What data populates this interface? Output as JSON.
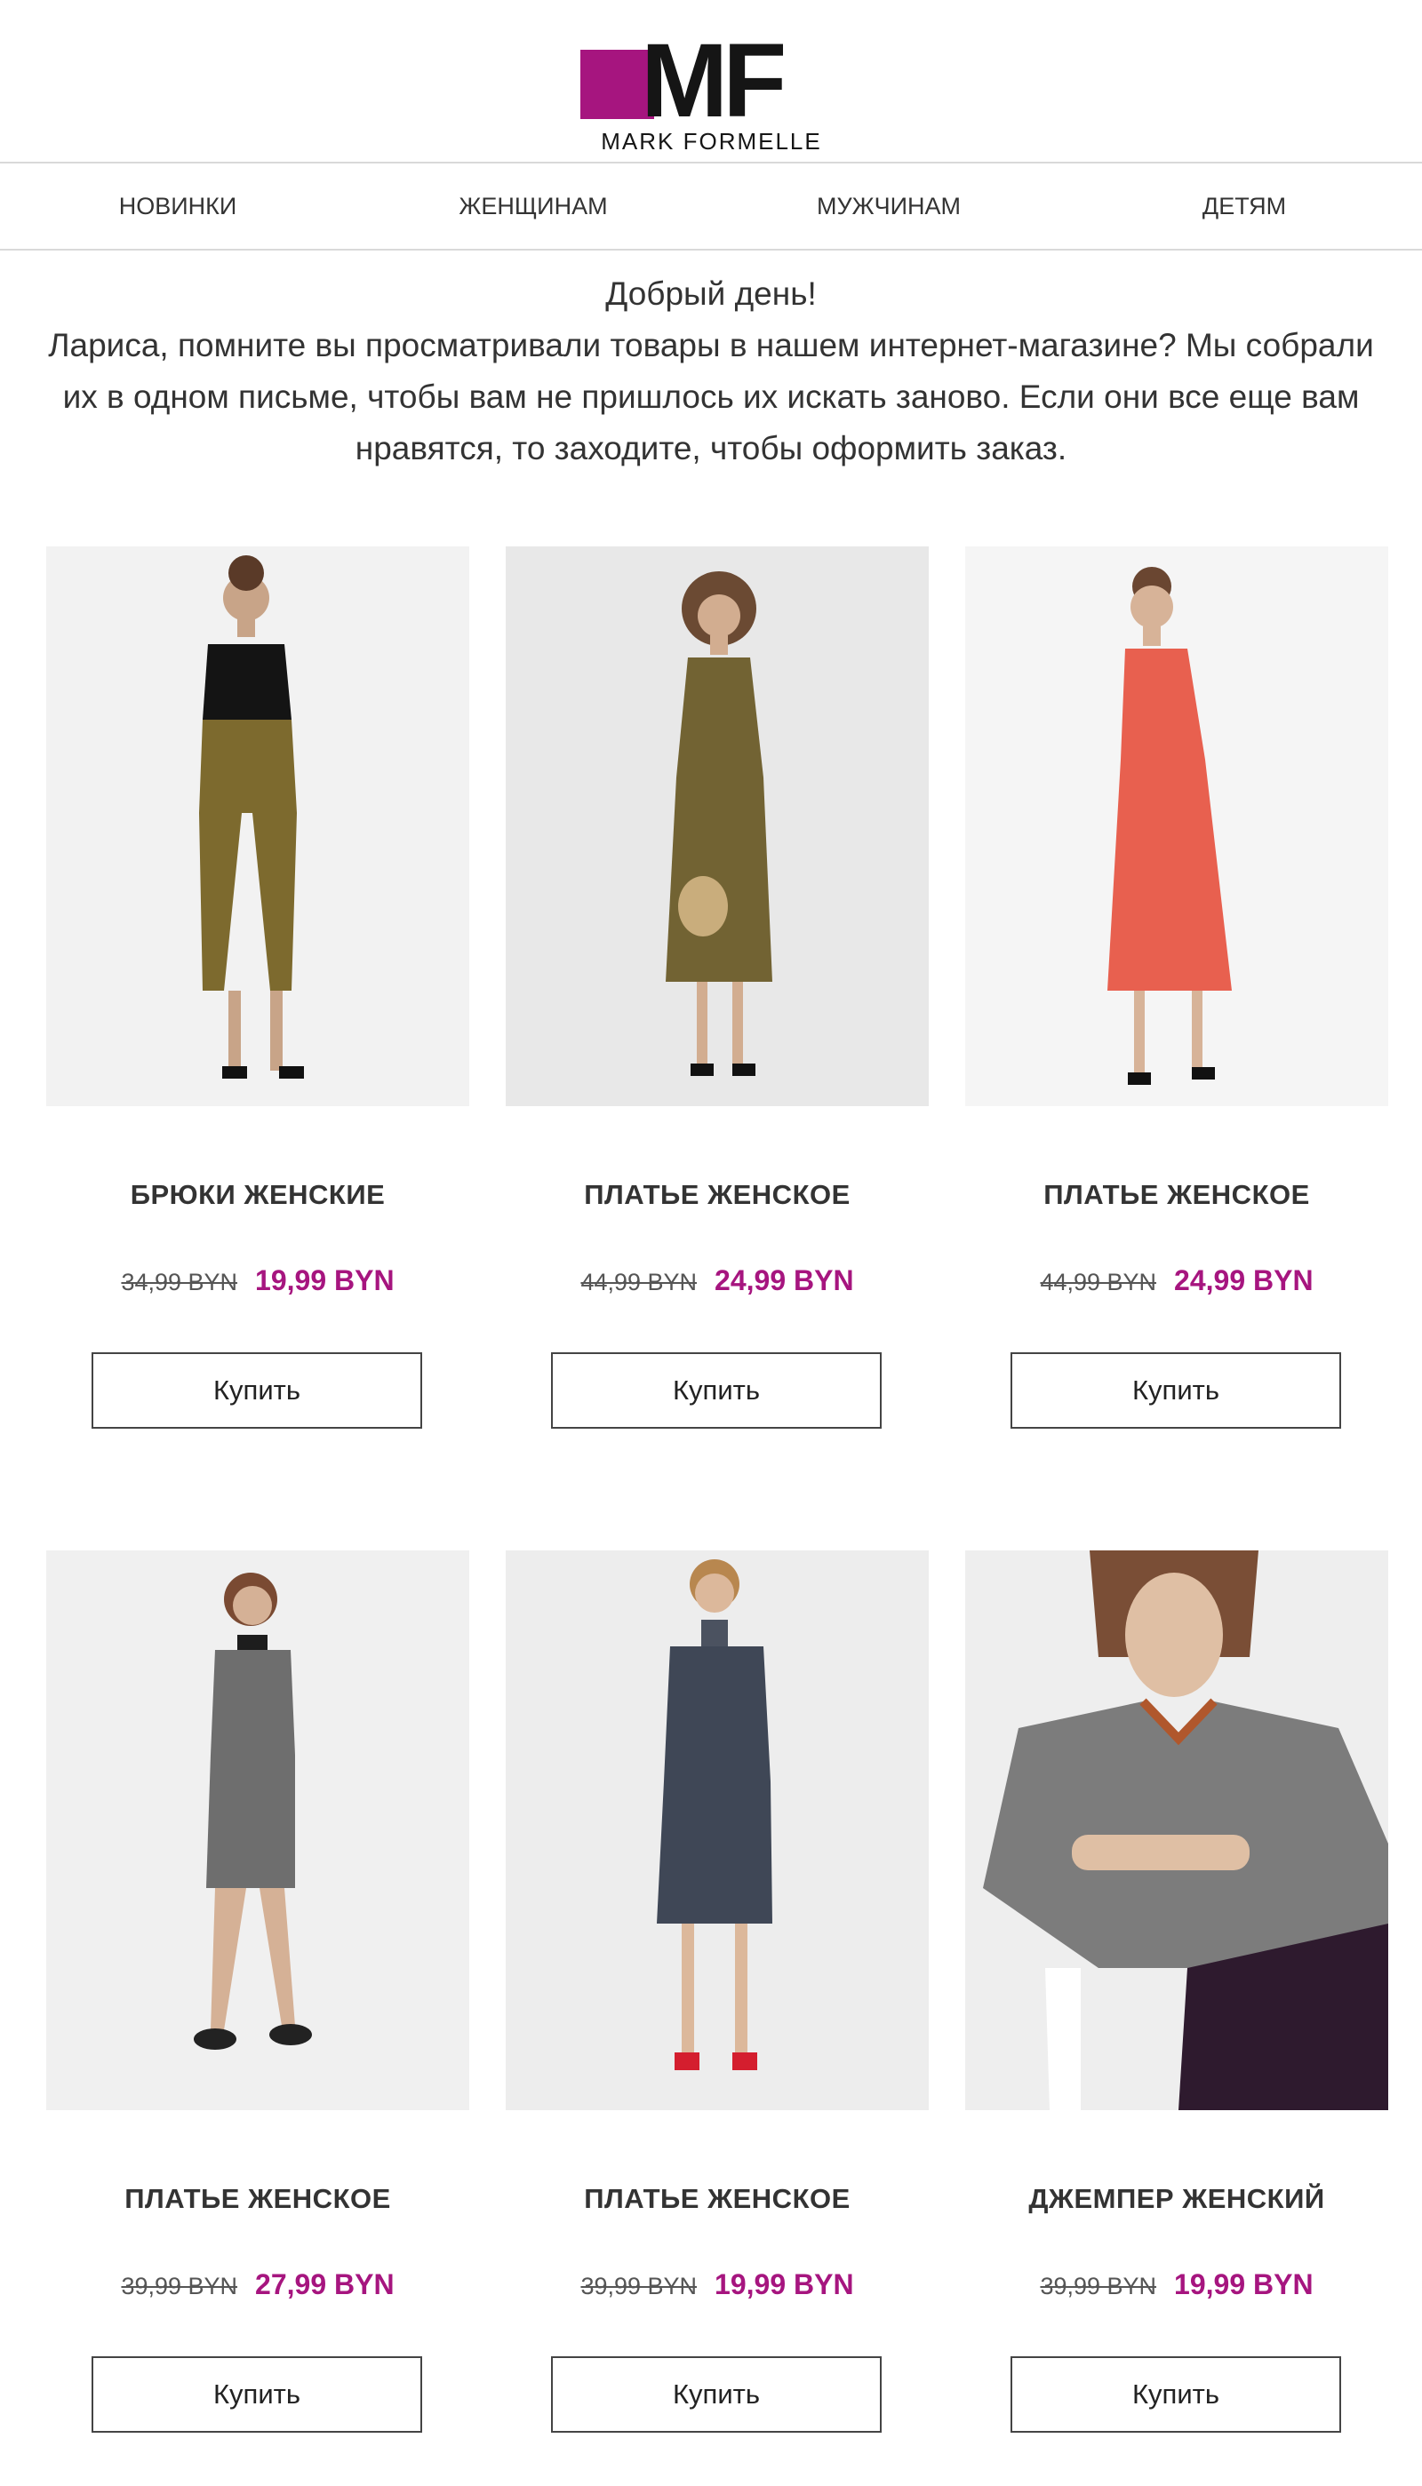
{
  "brand": {
    "logo_letters": "MF",
    "logo_name": "MARK FORMELLE",
    "color": "#a6157f"
  },
  "nav": [
    {
      "label": "НОВИНКИ"
    },
    {
      "label": "ЖЕНЩИНАМ"
    },
    {
      "label": "МУЖЧИНАМ"
    },
    {
      "label": "ДЕТЯМ"
    }
  ],
  "intro": {
    "greeting": "Добрый день!",
    "text": "Лариса, помните вы просматривали товары в нашем интернет-магазине? Мы собрали их в одном письме, чтобы вам не пришлось их искать заново. Если они все еще вам нравятся, то заходите, чтобы оформить заказ."
  },
  "products": [
    {
      "title": "БРЮКИ ЖЕНСКИЕ",
      "old_price": "34,99 BYN",
      "new_price": "19,99 BYN",
      "button": "Купить",
      "image": "woman-black-top-olive-trousers-photo"
    },
    {
      "title": "ПЛАТЬЕ ЖЕНСКОЕ",
      "old_price": "44,99 BYN",
      "new_price": "24,99 BYN",
      "button": "Купить",
      "image": "woman-olive-slip-dress-photo"
    },
    {
      "title": "ПЛАТЬЕ ЖЕНСКОЕ",
      "old_price": "44,99 BYN",
      "new_price": "24,99 BYN",
      "button": "Купить",
      "image": "woman-coral-slip-dress-photo"
    },
    {
      "title": "ПЛАТЬЕ ЖЕНСКОЕ",
      "old_price": "39,99 BYN",
      "new_price": "27,99 BYN",
      "button": "Купить",
      "image": "woman-grey-check-dress-photo"
    },
    {
      "title": "ПЛАТЬЕ ЖЕНСКОЕ",
      "old_price": "39,99 BYN",
      "new_price": "19,99 BYN",
      "button": "Купить",
      "image": "woman-navy-knit-dress-photo"
    },
    {
      "title": "ДЖЕМПЕР ЖЕНСКИЙ",
      "old_price": "39,99 BYN",
      "new_price": "19,99 BYN",
      "button": "Купить",
      "image": "woman-grey-check-jumper-photo"
    }
  ]
}
